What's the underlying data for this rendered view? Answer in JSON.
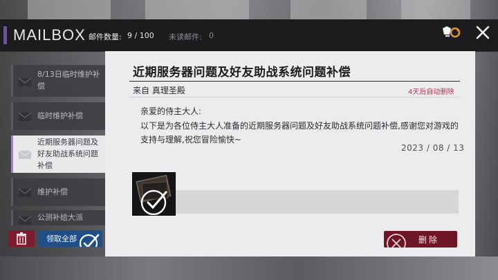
{
  "header": {
    "title": "MAILBOX",
    "mail_count_label": "邮件数量:",
    "mail_count_value": "9 / 100",
    "unread_label": "未读邮件:",
    "unread_value": "0"
  },
  "mail_list": [
    {
      "text": "8/13日临时维护补偿",
      "state": "read"
    },
    {
      "text": "临时维护补偿",
      "state": "read"
    },
    {
      "text": "近期服务器问题及好友助战系统问题补偿",
      "state": "selected"
    },
    {
      "text": "维护补偿",
      "state": "read"
    },
    {
      "text": "公测补给大派",
      "state": "read"
    }
  ],
  "actions": {
    "claim_all_label": "领取全部",
    "delete_label": "删除"
  },
  "mail": {
    "title": "近期服务器问题及好友助战系统问题补偿",
    "sender": "来自 真理圣殿",
    "expire_notice": "4天后自动删除",
    "greeting": "亲爱的侍主大人:",
    "body": "以下是为各位侍主大人准备的近期服务器问题及好友助战系统问题补偿,感谢您对游戏的支持与理解,祝您冒险愉快~",
    "date": "2023 / 08 / 13"
  },
  "colors": {
    "accent_purple": "#6b4fa1",
    "danger_red": "#7d1c2e",
    "claim_blue": "#1f4f86",
    "expire_text": "#c0334b"
  },
  "icons": {
    "swap": "swap-icon",
    "close": "close-icon",
    "envelope": "envelope-icon",
    "trash": "trash-icon",
    "check": "check-circle-icon",
    "cancel": "cancel-circle-icon"
  }
}
